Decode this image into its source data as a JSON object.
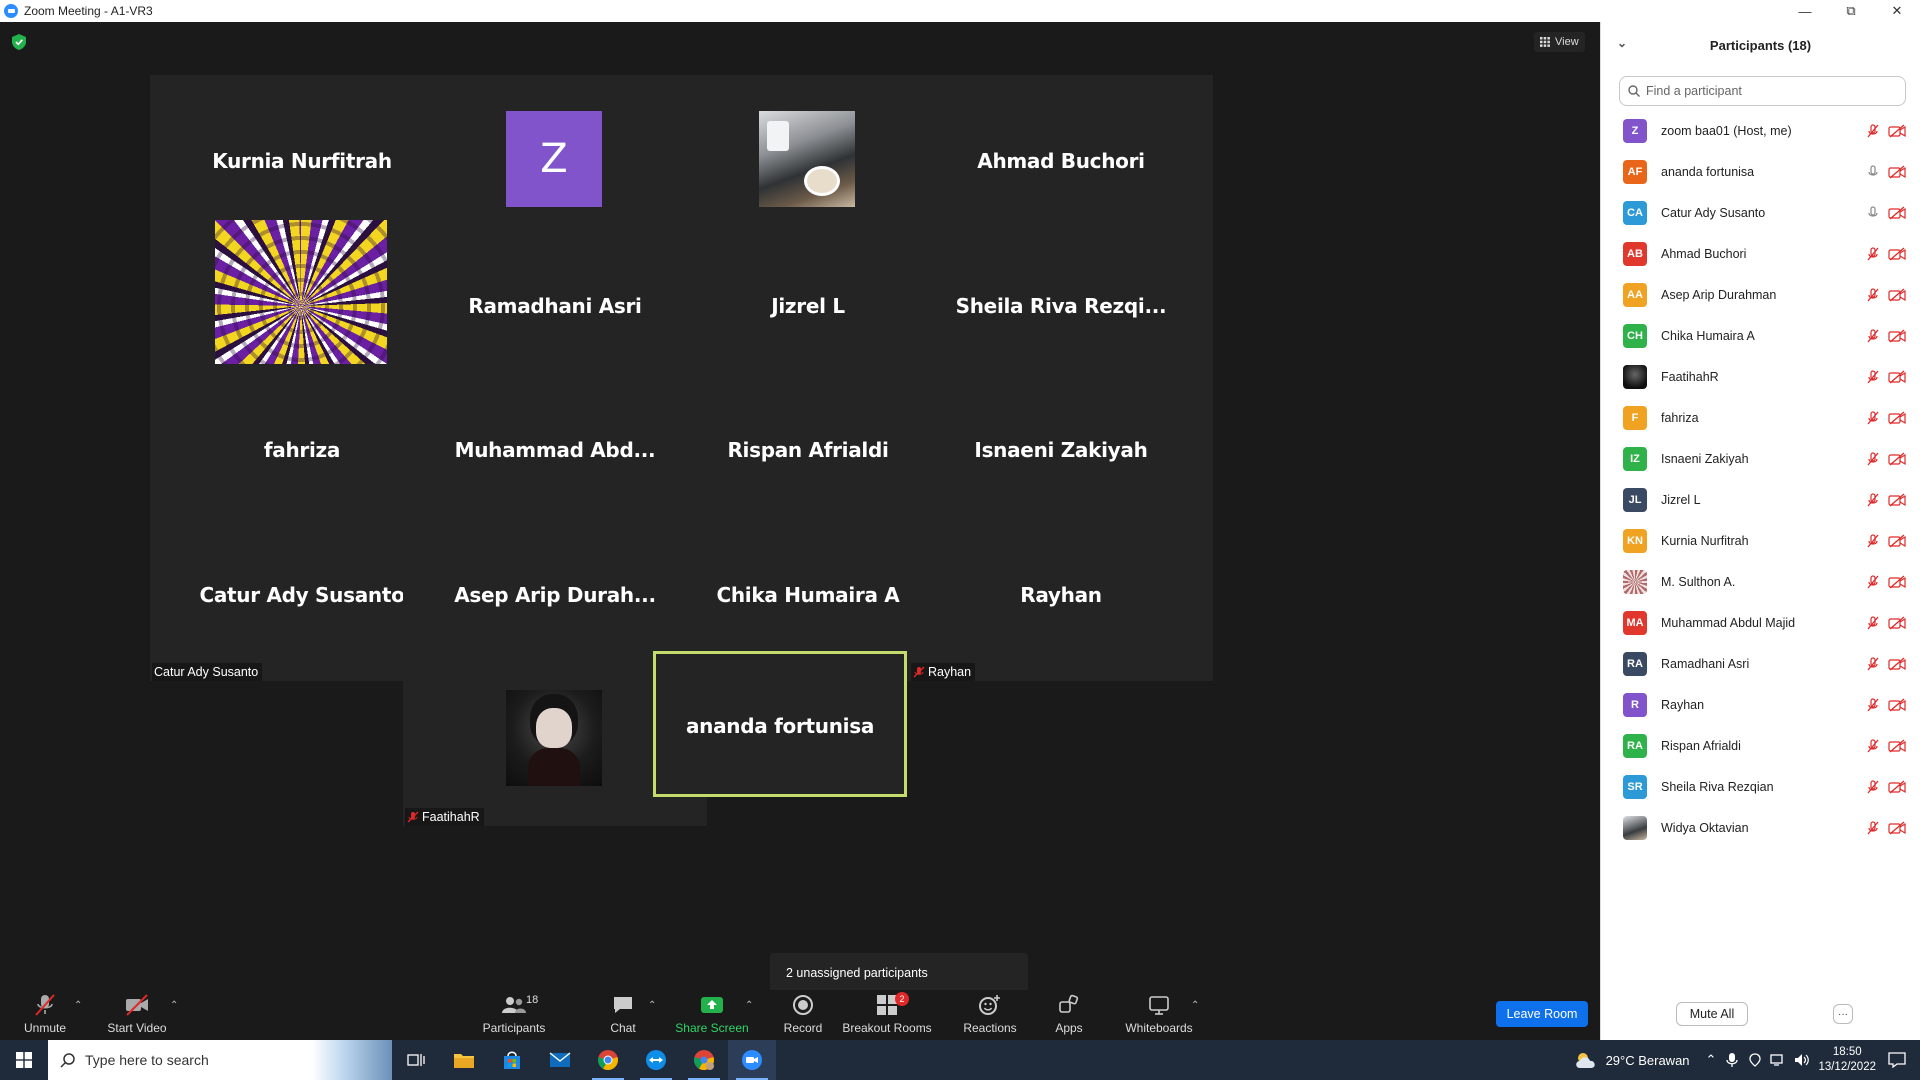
{
  "window": {
    "title": "Zoom Meeting - A1-VR3",
    "controls": [
      "minimize",
      "maximize",
      "close"
    ]
  },
  "meeting": {
    "view_label": "View",
    "tooltip": "2 unassigned participants",
    "tiles": [
      {
        "big": "Kurnia Nurfitrah",
        "caption": "Kurnia Nurfitrah",
        "muted": true,
        "media": "name"
      },
      {
        "big": "Z",
        "caption": "zoom baa01",
        "muted": true,
        "media": "avatar-z"
      },
      {
        "big": "",
        "caption": "Widya Oktavian",
        "muted": true,
        "media": "photo-cafe"
      },
      {
        "big": "Ahmad Buchori",
        "caption": "Ahmad Buchori",
        "muted": true,
        "media": "name"
      },
      {
        "big": "",
        "caption": "M. Sulthon A.",
        "muted": true,
        "media": "photo-illusion"
      },
      {
        "big": "Ramadhani Asri",
        "caption": "Ramadhani Asri",
        "muted": true,
        "media": "name"
      },
      {
        "big": "Jizrel L",
        "caption": "Jizrel L",
        "muted": true,
        "media": "name"
      },
      {
        "big": "Sheila  Riva  Rezqi...",
        "caption": "Sheila Riva Rezqian",
        "muted": true,
        "media": "name"
      },
      {
        "big": "fahriza",
        "caption": "fahriza",
        "muted": true,
        "media": "name"
      },
      {
        "big": "Muhammad  Abd...",
        "caption": "Muhammad Abdul Majid",
        "muted": true,
        "media": "name"
      },
      {
        "big": "Rispan Afrialdi",
        "caption": "Rispan Afrialdi",
        "muted": true,
        "media": "name"
      },
      {
        "big": "Isnaeni Zakiyah",
        "caption": "Isnaeni Zakiyah",
        "muted": true,
        "media": "name"
      },
      {
        "big": "Catur Ady Susanto",
        "caption": "Catur Ady Susanto",
        "muted": false,
        "media": "name"
      },
      {
        "big": "Asep  Arip  Durah...",
        "caption": "Asep Arip Durahman",
        "muted": true,
        "media": "name"
      },
      {
        "big": "Chika Humaira A",
        "caption": "Chika Humaira A",
        "muted": true,
        "media": "name"
      },
      {
        "big": "Rayhan",
        "caption": "Rayhan",
        "muted": true,
        "media": "name"
      },
      {
        "big": "",
        "caption": "FaatihahR",
        "muted": true,
        "media": "photo-dark"
      },
      {
        "big": "ananda fortunisa",
        "caption": "",
        "muted": false,
        "media": "name",
        "active": true
      }
    ]
  },
  "toolbar": {
    "unmute": "Unmute",
    "start_video": "Start Video",
    "participants": "Participants",
    "participants_count": "18",
    "chat": "Chat",
    "share_screen": "Share Screen",
    "record": "Record",
    "breakout_rooms": "Breakout Rooms",
    "breakout_badge": "2",
    "reactions": "Reactions",
    "apps": "Apps",
    "whiteboards": "Whiteboards",
    "leave": "Leave Room"
  },
  "participants_panel": {
    "title": "Participants (18)",
    "search_placeholder": "Find a participant",
    "mute_all": "Mute All",
    "more": "···",
    "list": [
      {
        "initials": "Z",
        "name": "zoom baa01 (Host, me)",
        "color": "#8154cc",
        "mic": "muted"
      },
      {
        "initials": "AF",
        "name": "ananda fortunisa",
        "color": "#e8651a",
        "mic": "on"
      },
      {
        "initials": "CA",
        "name": "Catur Ady Susanto",
        "color": "#2c9ad6",
        "mic": "on"
      },
      {
        "initials": "AB",
        "name": "Ahmad Buchori",
        "color": "#e0382d",
        "mic": "muted"
      },
      {
        "initials": "AA",
        "name": "Asep Arip Durahman",
        "color": "#f0a223",
        "mic": "muted"
      },
      {
        "initials": "CH",
        "name": "Chika Humaira A",
        "color": "#2fb24a",
        "mic": "muted"
      },
      {
        "initials": "",
        "name": "FaatihahR",
        "color": "#1a1a1a",
        "mic": "muted",
        "photo": "dark"
      },
      {
        "initials": "F",
        "name": "fahriza",
        "color": "#f0a223",
        "mic": "muted"
      },
      {
        "initials": "IZ",
        "name": "Isnaeni Zakiyah",
        "color": "#2fb24a",
        "mic": "muted"
      },
      {
        "initials": "JL",
        "name": "Jizrel L",
        "color": "#3a4a63",
        "mic": "muted"
      },
      {
        "initials": "KN",
        "name": "Kurnia Nurfitrah",
        "color": "#f0a223",
        "mic": "muted"
      },
      {
        "initials": "",
        "name": "M. Sulthon A.",
        "color": "#c9a0a0",
        "mic": "muted",
        "photo": "pattern"
      },
      {
        "initials": "MA",
        "name": "Muhammad Abdul Majid",
        "color": "#e0382d",
        "mic": "muted"
      },
      {
        "initials": "RA",
        "name": "Ramadhani Asri",
        "color": "#3a4a63",
        "mic": "muted"
      },
      {
        "initials": "R",
        "name": "Rayhan",
        "color": "#8154cc",
        "mic": "muted"
      },
      {
        "initials": "RA",
        "name": "Rispan Afrialdi",
        "color": "#2fb24a",
        "mic": "muted"
      },
      {
        "initials": "SR",
        "name": "Sheila Riva Rezqian",
        "color": "#2c9ad6",
        "mic": "muted"
      },
      {
        "initials": "",
        "name": "Widya Oktavian",
        "color": "#6f7b88",
        "mic": "muted",
        "photo": "cafe"
      }
    ]
  },
  "taskbar": {
    "search_placeholder": "Type here to search",
    "weather": "29°C  Berawan",
    "time": "18:50",
    "date": "13/12/2022",
    "apps": [
      "task-view",
      "file-explorer",
      "microsoft-store",
      "mail",
      "chrome",
      "teamviewer",
      "chrome-profile",
      "zoom"
    ]
  }
}
